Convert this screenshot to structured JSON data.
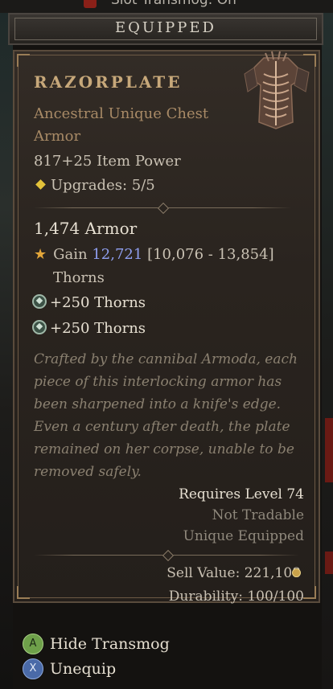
{
  "top_partial_text": "Slot Transmog: On",
  "header": {
    "title": "EQUIPPED"
  },
  "item": {
    "name": "RAZORPLATE",
    "type": "Ancestral Unique Chest Armor",
    "item_power": "817+25 Item Power",
    "upgrades": "Upgrades: 5/5",
    "armor": "1,474 Armor",
    "gain_label": "Gain",
    "gain_value": "12,721",
    "gain_range": "[10,076 - 13,854]",
    "gain_stat": "Thorns",
    "affixes": [
      "+250 Thorns",
      "+250 Thorns"
    ],
    "flavor_text": "Crafted by the cannibal Armoda, each piece of this interlocking armor has been sharpened into a knife's edge. Even a century after death, the plate remained on her corpse, unable to be removed safely.",
    "requires_level": "Requires Level 74",
    "tradable": "Not Tradable",
    "unique_equipped": "Unique Equipped",
    "sell_value": "Sell Value: 221,108",
    "durability": "Durability: 100/100"
  },
  "controls": [
    {
      "button": "A",
      "label": "Hide Transmog"
    },
    {
      "button": "X",
      "label": "Unequip"
    }
  ],
  "colors": {
    "item_name": "#c7a87a",
    "unique_type": "#a88a66",
    "gain_number": "#8f9ff0",
    "upgrade_diamond": "#e3c23a",
    "button_a": "#6ea04a",
    "button_x": "#4a6aa8"
  },
  "icons": [
    "transmog-slot-icon",
    "item-chest-armor-image",
    "upgrade-diamond-icon",
    "star-icon",
    "affix-icon",
    "gold-coin-icon"
  ]
}
